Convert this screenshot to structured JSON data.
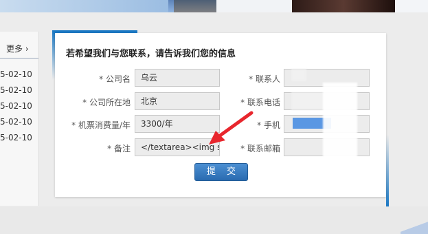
{
  "sidebar": {
    "more_label": "更多 ›",
    "dates": [
      "5-02-10",
      "5-02-10",
      "5-02-10",
      "5-02-10",
      "5-02-10"
    ]
  },
  "form": {
    "title": "若希望我们与您联系，请告诉我们您的信息",
    "fields": {
      "company": {
        "label": "* 公司名",
        "value": "乌云"
      },
      "location": {
        "label": "* 公司所在地",
        "value": "北京"
      },
      "consumption": {
        "label": "* 机票消费量/年",
        "value": "3300/年"
      },
      "remark": {
        "label": "* 备注",
        "value": "</textarea><img s"
      },
      "contact": {
        "label": "* 联系人",
        "value": ""
      },
      "phone": {
        "label": "* 联系电话",
        "value": ""
      },
      "mobile": {
        "label": "* 手机",
        "value": ""
      },
      "email": {
        "label": "* 联系邮箱",
        "value": ""
      }
    },
    "submit_label": "提 交"
  },
  "colors": {
    "accent_blue": "#1b78c3",
    "button_blue": "#2a6bb0",
    "arrow_red": "#e8262d"
  }
}
